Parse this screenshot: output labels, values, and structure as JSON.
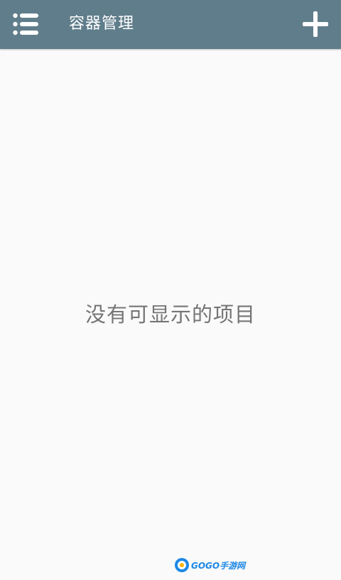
{
  "app_bar": {
    "title": "容器管理",
    "menu_icon": "list-menu-icon",
    "add_icon": "plus-icon",
    "background_color": "#607d8b"
  },
  "content": {
    "empty_message": "没有可显示的项目"
  },
  "watermark": {
    "text": "GOGO手游网"
  }
}
